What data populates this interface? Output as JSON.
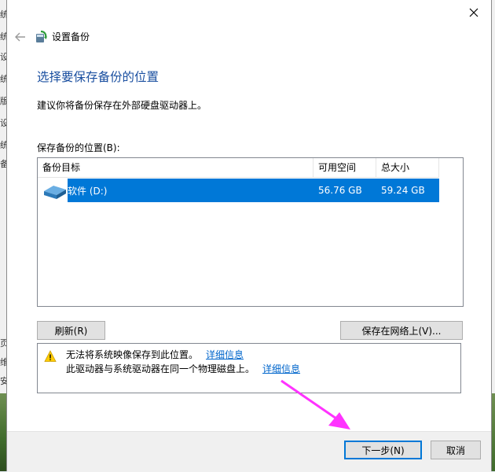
{
  "background": {
    "left_glyphs": [
      "统",
      "统",
      "设",
      "统",
      "版",
      "设",
      "统",
      "备",
      "页",
      "维",
      "安"
    ]
  },
  "dialog": {
    "app_title": "设置备份",
    "heading": "选择要保存备份的位置",
    "intro": "建议你将备份保存在外部硬盘驱动器上。",
    "location_label": "保存备份的位置(B):",
    "columns": [
      "备份目标",
      "可用空间",
      "总大小"
    ],
    "rows": [
      {
        "name": "软件 (D:)",
        "free": "56.76 GB",
        "total": "59.24 GB",
        "selected": true,
        "icon": "drive-icon"
      }
    ],
    "refresh_label": "刷新(R)",
    "save_network_label": "保存在网络上(V)...",
    "warnings": [
      {
        "text": "无法将系统映像保存到此位置。",
        "link": "详细信息"
      },
      {
        "text": "此驱动器与系统驱动器在同一个物理磁盘上。",
        "link": "详细信息"
      }
    ],
    "next_label": "下一步(N)",
    "cancel_label": "取消"
  },
  "colors": {
    "accent": "#0078d7",
    "heading": "#1a4fa0",
    "link": "#0066cc",
    "annotation_arrow": "#ff33ff"
  }
}
